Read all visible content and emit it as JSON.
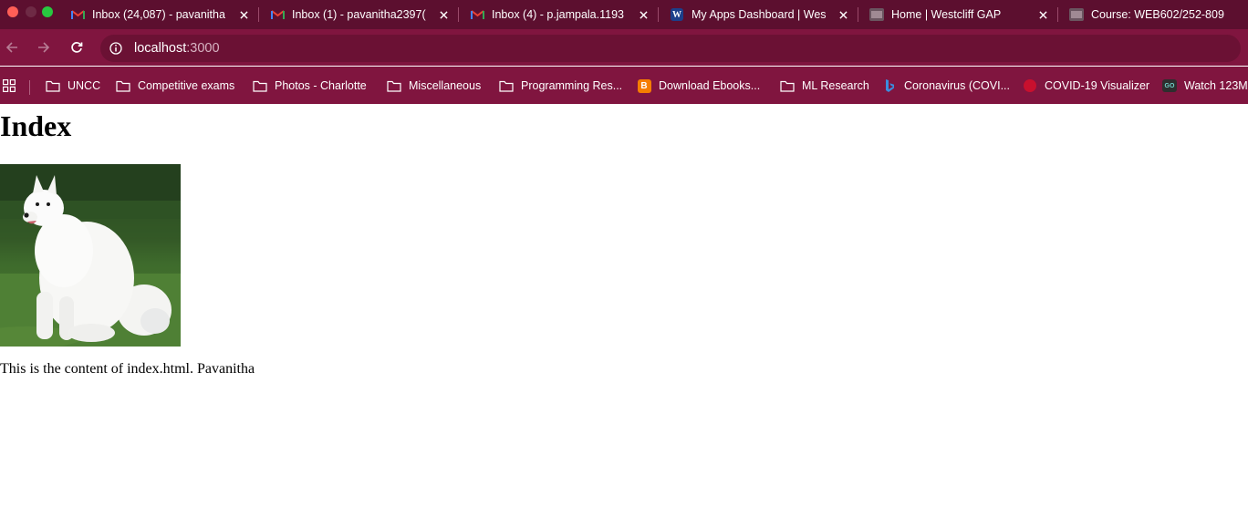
{
  "tabs": [
    {
      "title": "Inbox (24,087) - pavanitha",
      "icon": "gmail-icon"
    },
    {
      "title": "Inbox (1) - pavanitha2397(",
      "icon": "gmail-icon"
    },
    {
      "title": "Inbox (4) - p.jampala.1193",
      "icon": "gmail-icon"
    },
    {
      "title": "My Apps Dashboard | Wes",
      "icon": "westcliff-icon",
      "icon_letter": "W"
    },
    {
      "title": "Home | Westcliff GAP",
      "icon": "page-thumbnail-icon"
    },
    {
      "title": "Course: WEB602/252-809",
      "icon": "page-thumbnail-icon"
    }
  ],
  "address": {
    "host": "localhost",
    "port": ":3000"
  },
  "bookmarks": [
    {
      "label": "UNCC",
      "icon": "folder-icon"
    },
    {
      "label": "Competitive exams",
      "icon": "folder-icon"
    },
    {
      "label": "Photos - Charlotte",
      "icon": "folder-icon"
    },
    {
      "label": "Miscellaneous",
      "icon": "folder-icon"
    },
    {
      "label": "Programming Res...",
      "icon": "folder-icon"
    },
    {
      "label": "Download Ebooks...",
      "icon": "blogger-icon",
      "icon_letter": "B"
    },
    {
      "label": "ML Research",
      "icon": "folder-icon"
    },
    {
      "label": "Coronavirus (COVI...",
      "icon": "bing-icon"
    },
    {
      "label": "COVID-19 Visualizer",
      "icon": "virus-icon"
    },
    {
      "label": "Watch 123M",
      "icon": "go-icon",
      "icon_letter": "GO"
    }
  ],
  "page": {
    "heading": "Index",
    "text": "This is the content of index.html. Pavanitha",
    "image": "white-dog-photo"
  },
  "colors": {
    "tab_strip": "#5c0f2f",
    "toolbar": "#80153f",
    "omnibox": "#6b1134"
  }
}
